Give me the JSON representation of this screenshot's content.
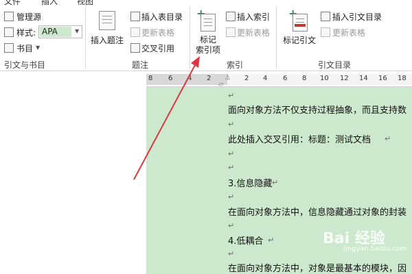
{
  "menubar": {
    "items": [
      "文件",
      "插入",
      "视图"
    ]
  },
  "citations_group": {
    "manage_sources": "管理源",
    "style_label": "样式:",
    "style_value": "APA",
    "bibliography": "书目",
    "group_label": "引文与书目"
  },
  "captions_group": {
    "insert_caption": "插入题注",
    "insert_table_of_figures": "插入表目录",
    "update_table": "更新表格",
    "cross_reference": "交叉引用",
    "group_label": "题注"
  },
  "index_group": {
    "mark_entry_line1": "标记",
    "mark_entry_line2": "索引项",
    "insert_index": "插入索引",
    "update_index": "更新表格",
    "group_label": "索引"
  },
  "authorities_group": {
    "mark_citation": "标记引文",
    "insert_table_of_authorities": "插入引文目录",
    "update_table": "更新表格",
    "group_label": "引文目录"
  },
  "ruler": {
    "numbers": [
      "8",
      "6",
      "4",
      "2",
      "2",
      "4",
      "6",
      "8",
      "10",
      "12",
      "14",
      "16",
      "18"
    ]
  },
  "document": {
    "lines": [
      "面向对象方法不仅支持过程抽象，而且支持数",
      "此处插入交叉引用：标题：测试文档",
      "3.信息隐藏",
      "在面向对象方法中，信息隐藏通过对象的封装",
      "4.低耦合",
      "在面向对象方法中，对象是最基本的模块，因"
    ],
    "paragraph_mark": "↵"
  },
  "watermark": {
    "text": "Bai 经验",
    "sub": "jingyan.baidu.com"
  },
  "colors": {
    "doc_bg": "#cde9cd",
    "arrow": "#e0353f",
    "accent": "#2f8a57"
  }
}
